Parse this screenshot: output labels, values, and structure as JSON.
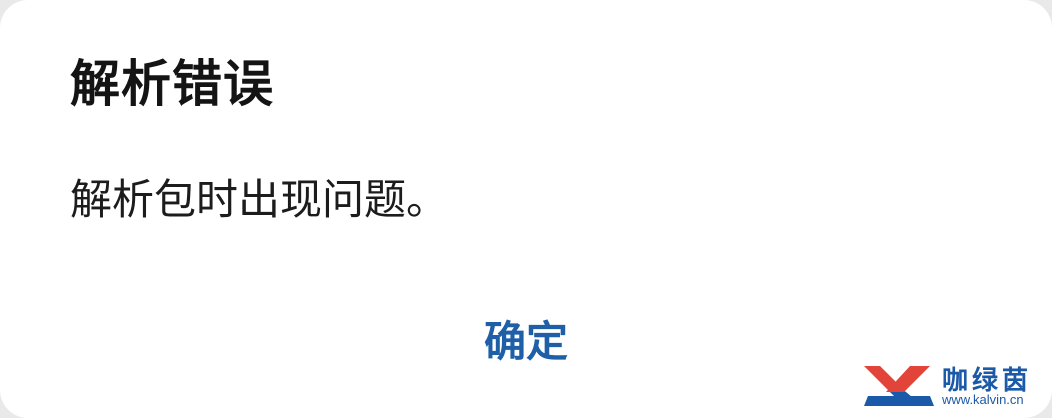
{
  "dialog": {
    "title": "解析错误",
    "message": "解析包时出现问题。",
    "ok_label": "确定"
  },
  "watermark": {
    "name": "咖绿茵",
    "url": "www.kalvin.cn",
    "colors": {
      "red": "#e2443a",
      "blue": "#1b5aa8"
    }
  },
  "colors": {
    "accent": "#1f5fa8",
    "background": "#ffffff",
    "text": "#141414"
  }
}
